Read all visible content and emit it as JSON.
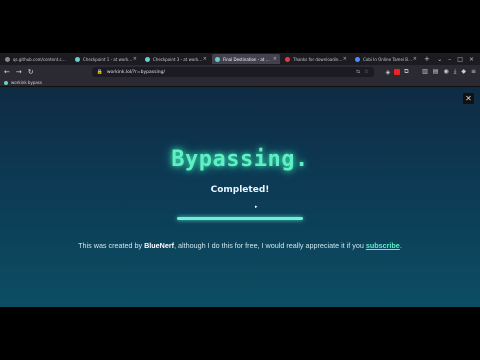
{
  "tabs": [
    {
      "label": "qs.github.com/content.com/fix",
      "active": false,
      "fav_color": "#888888"
    },
    {
      "label": "Checkpoint 1 - at workink",
      "active": false,
      "fav_color": "#62d0c9"
    },
    {
      "label": "Checkpoint 3 - at work.ink",
      "active": false,
      "fav_color": "#62d0c9"
    },
    {
      "label": "Final Destination - at work.ink",
      "active": true,
      "fav_color": "#62d0c9"
    },
    {
      "label": "Thanks for downloading Opera",
      "active": false,
      "fav_color": "#e23b3b"
    },
    {
      "label": "Cobi In Online Tamei Bantay...",
      "active": false,
      "fav_color": "#4a8cff"
    }
  ],
  "nav": {
    "url": "workink.lol/?r=bypassing/"
  },
  "bookmarks": [
    {
      "label": "workink bypass"
    }
  ],
  "page": {
    "title": "Bypassing.",
    "status": "Completed!",
    "progress": 1.0,
    "credit_prefix": "This was created by ",
    "credit_author": "BlueNerf",
    "credit_middle": ", although I do this for free, I would really appreciate it if you ",
    "credit_link": "subscribe",
    "credit_suffix": "."
  },
  "colors": {
    "title_glow": "#5ff0c4",
    "page_bg_top": "#0f2b44",
    "page_bg_bottom": "#0b4e63",
    "link": "#5cf0c8"
  }
}
